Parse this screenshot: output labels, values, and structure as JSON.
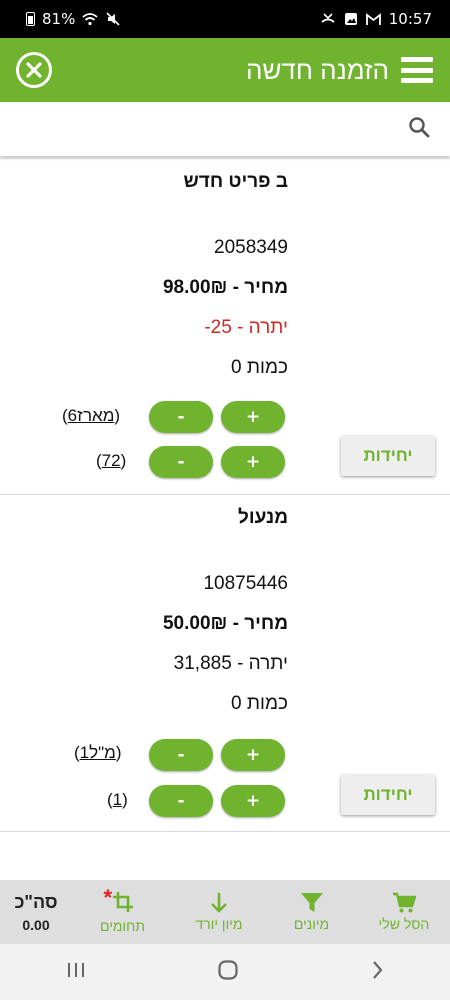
{
  "status": {
    "battery": "81%",
    "time": "10:57"
  },
  "header": {
    "title": "הזמנה חדשה"
  },
  "search": {
    "placeholder": ""
  },
  "products": [
    {
      "name": "ב פריט חדש",
      "sku": "2058349",
      "price": "מחיר - 98.00₪",
      "balance": "יתרה - 25-",
      "quantity": "כמות 0",
      "pkg1_count": "6",
      "pkg1_unit": "מארז",
      "pkg2_count": "72",
      "units_label": "יחידות"
    },
    {
      "name": "מנעול",
      "sku": "10875446",
      "price": "מחיר - 50.00₪",
      "balance": "יתרה - 31,885",
      "quantity": "כמות 0",
      "pkg1_count": "1",
      "pkg1_unit": "מ\"ל",
      "pkg2_count": "1",
      "units_label": "יחידות"
    }
  ],
  "buttons": {
    "plus": "+",
    "minus": "-"
  },
  "toolbar": {
    "cart": "הסל שלי",
    "sorts": "מיונים",
    "sort_desc": "מיון יורד",
    "domains": "תחומים",
    "total_label": "סה\"כ",
    "total_value": "0.00"
  },
  "colors": {
    "accent": "#6fb32e",
    "negative": "#d32626"
  }
}
